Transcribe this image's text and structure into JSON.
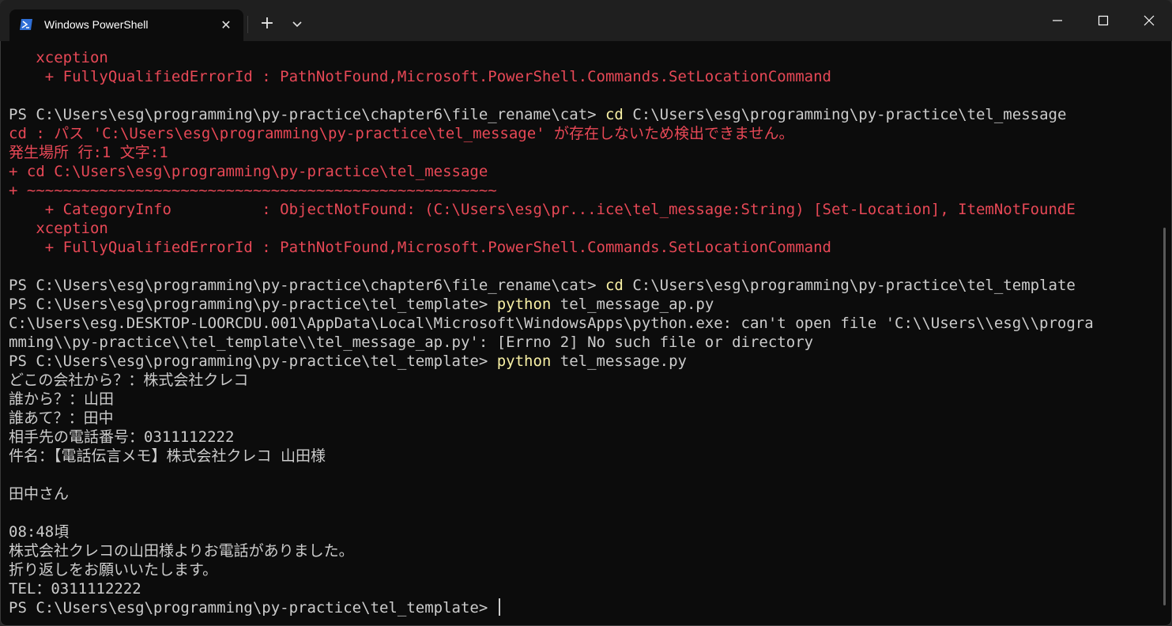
{
  "window": {
    "tab_title": "Windows PowerShell",
    "new_tab_label": "+",
    "close_tab_label": "✕"
  },
  "colors": {
    "error": "#e74856",
    "command": "#f9f1a5",
    "text": "#cccccc",
    "background": "#0c0c0c"
  },
  "terminal": {
    "lines": [
      {
        "parts": [
          {
            "text": "   xception",
            "style": "err"
          }
        ]
      },
      {
        "parts": [
          {
            "text": "    + FullyQualifiedErrorId : PathNotFound,Microsoft.PowerShell.Commands.SetLocationCommand",
            "style": "err"
          }
        ]
      },
      {
        "parts": [
          {
            "text": "",
            "style": "out"
          }
        ]
      },
      {
        "parts": [
          {
            "text": "PS C:\\Users\\esg\\programming\\py-practice\\chapter6\\file_rename\\cat> ",
            "style": "out"
          },
          {
            "text": "cd",
            "style": "cmd"
          },
          {
            "text": " C:\\Users\\esg\\programming\\py-practice\\tel_message",
            "style": "out"
          }
        ]
      },
      {
        "parts": [
          {
            "text": "cd : パス 'C:\\Users\\esg\\programming\\py-practice\\tel_message' が存在しないため検出できません。",
            "style": "err"
          }
        ]
      },
      {
        "parts": [
          {
            "text": "発生場所 行:1 文字:1",
            "style": "err"
          }
        ]
      },
      {
        "parts": [
          {
            "text": "+ cd C:\\Users\\esg\\programming\\py-practice\\tel_message",
            "style": "err"
          }
        ]
      },
      {
        "parts": [
          {
            "text": "+ ~~~~~~~~~~~~~~~~~~~~~~~~~~~~~~~~~~~~~~~~~~~~~~~~~~~~",
            "style": "err"
          }
        ]
      },
      {
        "parts": [
          {
            "text": "    + CategoryInfo          : ObjectNotFound: (C:\\Users\\esg\\pr...ice\\tel_message:String) [Set-Location], ItemNotFoundE",
            "style": "err"
          }
        ]
      },
      {
        "parts": [
          {
            "text": "   xception",
            "style": "err"
          }
        ]
      },
      {
        "parts": [
          {
            "text": "    + FullyQualifiedErrorId : PathNotFound,Microsoft.PowerShell.Commands.SetLocationCommand",
            "style": "err"
          }
        ]
      },
      {
        "parts": [
          {
            "text": "",
            "style": "out"
          }
        ]
      },
      {
        "parts": [
          {
            "text": "PS C:\\Users\\esg\\programming\\py-practice\\chapter6\\file_rename\\cat> ",
            "style": "out"
          },
          {
            "text": "cd",
            "style": "cmd"
          },
          {
            "text": " C:\\Users\\esg\\programming\\py-practice\\tel_template",
            "style": "out"
          }
        ]
      },
      {
        "parts": [
          {
            "text": "PS C:\\Users\\esg\\programming\\py-practice\\tel_template> ",
            "style": "out"
          },
          {
            "text": "python",
            "style": "cmd"
          },
          {
            "text": " tel_message_ap.py",
            "style": "out"
          }
        ]
      },
      {
        "parts": [
          {
            "text": "C:\\Users\\esg.DESKTOP-LOORCDU.001\\AppData\\Local\\Microsoft\\WindowsApps\\python.exe: can't open file 'C:\\\\Users\\\\esg\\\\progra",
            "style": "out"
          }
        ]
      },
      {
        "parts": [
          {
            "text": "mming\\\\py-practice\\\\tel_template\\\\tel_message_ap.py': [Errno 2] No such file or directory",
            "style": "out"
          }
        ]
      },
      {
        "parts": [
          {
            "text": "PS C:\\Users\\esg\\programming\\py-practice\\tel_template> ",
            "style": "out"
          },
          {
            "text": "python",
            "style": "cmd"
          },
          {
            "text": " tel_message.py",
            "style": "out"
          }
        ]
      },
      {
        "parts": [
          {
            "text": "どこの会社から？：株式会社クレコ",
            "style": "out"
          }
        ]
      },
      {
        "parts": [
          {
            "text": "誰から？：山田",
            "style": "out"
          }
        ]
      },
      {
        "parts": [
          {
            "text": "誰あて？：田中",
            "style": "out"
          }
        ]
      },
      {
        "parts": [
          {
            "text": "相手先の電話番号：0311112222",
            "style": "out"
          }
        ]
      },
      {
        "parts": [
          {
            "text": "件名：【電話伝言メモ】株式会社クレコ 山田様",
            "style": "out"
          }
        ]
      },
      {
        "parts": [
          {
            "text": "",
            "style": "out"
          }
        ]
      },
      {
        "parts": [
          {
            "text": "田中さん",
            "style": "out"
          }
        ]
      },
      {
        "parts": [
          {
            "text": "",
            "style": "out"
          }
        ]
      },
      {
        "parts": [
          {
            "text": "08:48頃",
            "style": "out"
          }
        ]
      },
      {
        "parts": [
          {
            "text": "株式会社クレコの山田様よりお電話がありました。",
            "style": "out"
          }
        ]
      },
      {
        "parts": [
          {
            "text": "折り返しをお願いいたします。",
            "style": "out"
          }
        ]
      },
      {
        "parts": [
          {
            "text": "TEL：0311112222",
            "style": "out"
          }
        ]
      },
      {
        "parts": [
          {
            "text": "PS C:\\Users\\esg\\programming\\py-practice\\tel_template> ",
            "style": "out"
          }
        ],
        "cursor": true
      }
    ]
  }
}
